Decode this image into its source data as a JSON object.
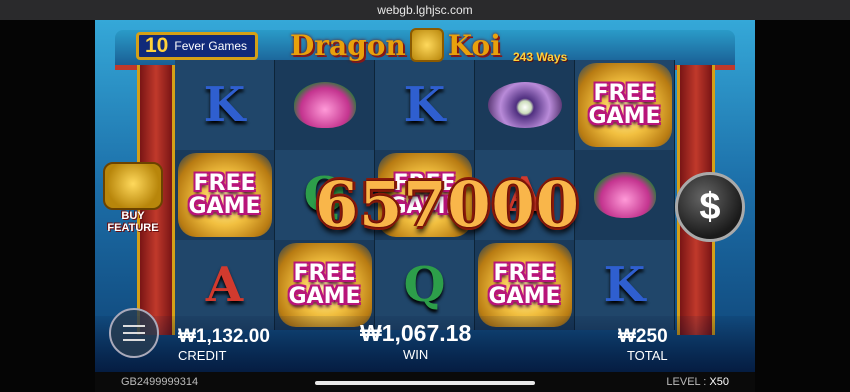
{
  "browser": {
    "url": "webgb.lghjsc.com"
  },
  "game": {
    "fever_count": "10",
    "fever_label": "Fever Games",
    "logo_left": "Dragon",
    "logo_right": "Koi",
    "ways": "243 Ways",
    "buy_feature": "BUY FEATURE",
    "win_display": "657000",
    "spin_icon": "$"
  },
  "reels": [
    [
      "K",
      "lotus",
      "K",
      "pearl",
      "FREE GAME"
    ],
    [
      "FREE GAME",
      "Q",
      "FREE GAME",
      "A",
      "lotus"
    ],
    [
      "A",
      "FREE GAME",
      "Q",
      "FREE GAME",
      "K"
    ]
  ],
  "free_game_line1": "FREE",
  "free_game_line2": "GAME",
  "stats": {
    "credit_value": "₩1,132.00",
    "credit_label": "CREDIT",
    "win_value": "₩1,067.18",
    "win_label": "WIN",
    "total_value": "₩250",
    "total_label": "TOTAL"
  },
  "footer": {
    "player_id": "GB2499999314",
    "level_label": "LEVEL :",
    "level_value": "X50"
  }
}
